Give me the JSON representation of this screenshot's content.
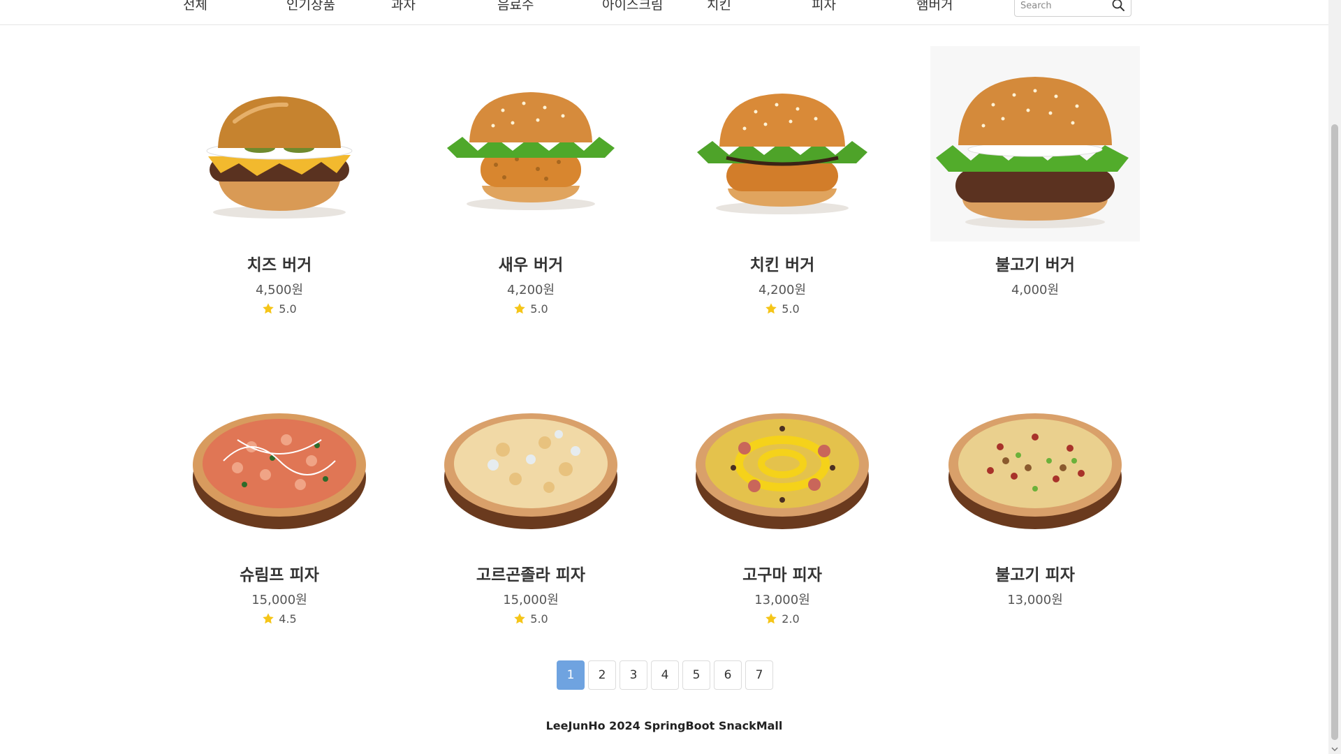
{
  "nav": {
    "items": [
      "전체",
      "인기상품",
      "과자",
      "음료수",
      "아이스크림",
      "치킨",
      "피자",
      "햄버거"
    ],
    "search_placeholder": "Search"
  },
  "products": [
    {
      "name": "치즈 버거",
      "price": "4,500원",
      "rating": "5.0",
      "kind": "burger-cheese"
    },
    {
      "name": "새우 버거",
      "price": "4,200원",
      "rating": "5.0",
      "kind": "burger-shrimp"
    },
    {
      "name": "치킨 버거",
      "price": "4,200원",
      "rating": "5.0",
      "kind": "burger-chicken"
    },
    {
      "name": "불고기 버거",
      "price": "4,000원",
      "rating": "",
      "kind": "burger-bulgogi"
    },
    {
      "name": "슈림프 피자",
      "price": "15,000원",
      "rating": "4.5",
      "kind": "pizza-shrimp"
    },
    {
      "name": "고르곤졸라 피자",
      "price": "15,000원",
      "rating": "5.0",
      "kind": "pizza-gorgonzola"
    },
    {
      "name": "고구마 피자",
      "price": "13,000원",
      "rating": "2.0",
      "kind": "pizza-sweetpotato"
    },
    {
      "name": "불고기 피자",
      "price": "13,000원",
      "rating": "",
      "kind": "pizza-bulgogi"
    }
  ],
  "pagination": {
    "pages": [
      "1",
      "2",
      "3",
      "4",
      "5",
      "6",
      "7"
    ],
    "current": "1"
  },
  "footer": {
    "text": "LeeJunHo 2024 SpringBoot SnackMall"
  },
  "colors": {
    "accent": "#6fa3e0",
    "star": "#f5c518"
  }
}
